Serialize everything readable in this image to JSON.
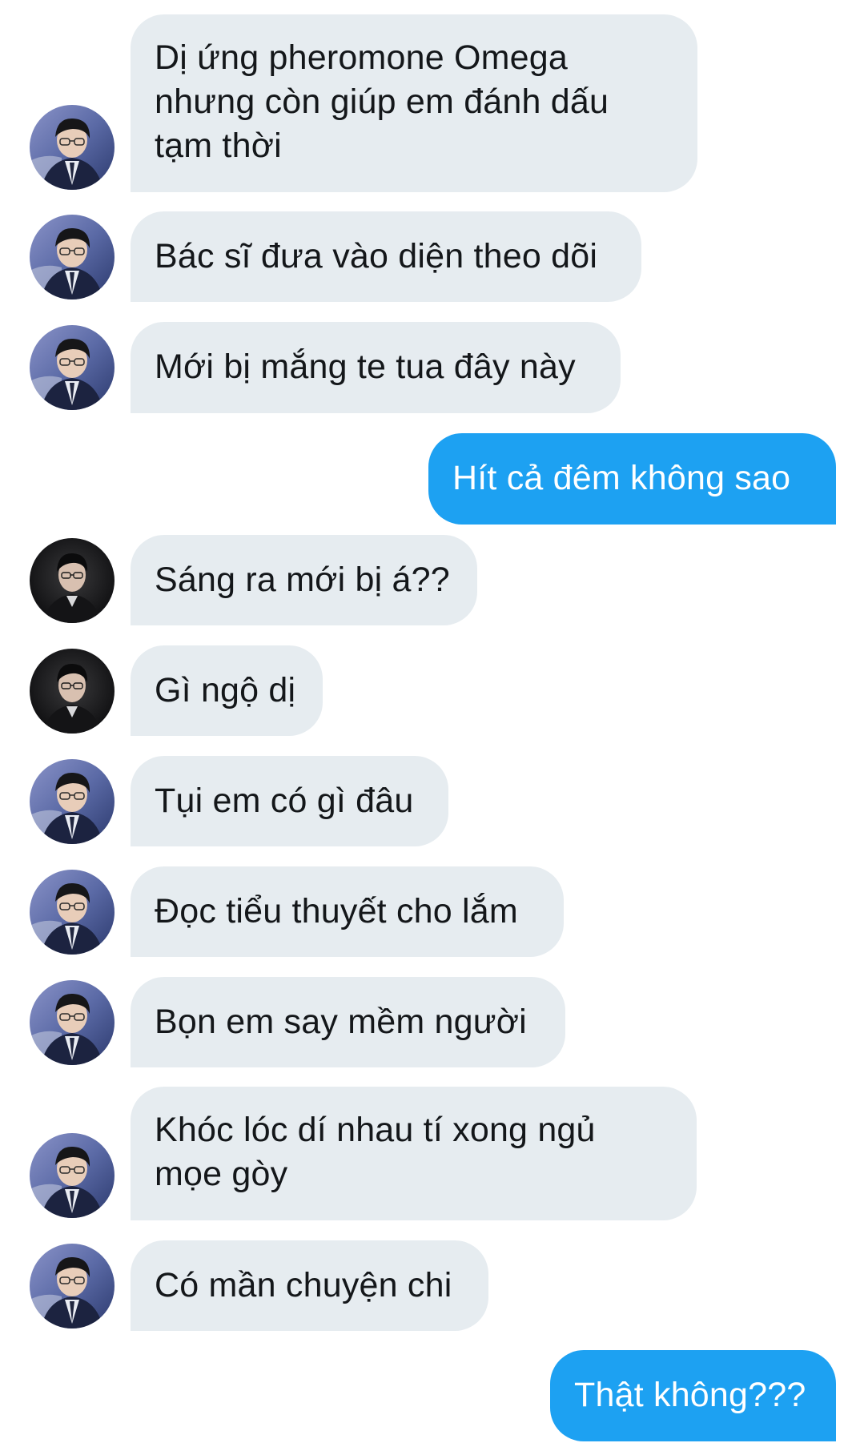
{
  "colors": {
    "incoming_bubble": "#e6ecf0",
    "outgoing_bubble": "#1da1f2",
    "incoming_text": "#14171a",
    "outgoing_text": "#ffffff"
  },
  "messages": [
    {
      "side": "incoming",
      "avatar": "avatar-suit-person",
      "text": "Dị ứng pheromone Omega\nnhưng còn giúp em đánh dấu\ntạm thời"
    },
    {
      "side": "incoming",
      "avatar": "avatar-suit-person",
      "text": "Bác sĩ đưa vào diện theo dõi"
    },
    {
      "side": "incoming",
      "avatar": "avatar-suit-person",
      "text": "Mới bị mắng te tua đây này"
    },
    {
      "side": "outgoing",
      "text": "Hít cả đêm không sao"
    },
    {
      "side": "incoming",
      "avatar": "avatar-dark-person",
      "text": "Sáng ra mới bị á??"
    },
    {
      "side": "incoming",
      "avatar": "avatar-dark-person",
      "text": "Gì ngộ dị"
    },
    {
      "side": "incoming",
      "avatar": "avatar-suit-person",
      "text": "Tụi em có gì đâu"
    },
    {
      "side": "incoming",
      "avatar": "avatar-suit-person",
      "text": "Đọc tiểu thuyết cho lắm"
    },
    {
      "side": "incoming",
      "avatar": "avatar-suit-person",
      "text": "Bọn em say mềm người"
    },
    {
      "side": "incoming",
      "avatar": "avatar-suit-person",
      "text": "Khóc lóc dí nhau tí xong ngủ\nmọe gòy"
    },
    {
      "side": "incoming",
      "avatar": "avatar-suit-person",
      "text": "Có mần chuyện chi"
    },
    {
      "side": "outgoing",
      "text": "Thật không???"
    }
  ]
}
